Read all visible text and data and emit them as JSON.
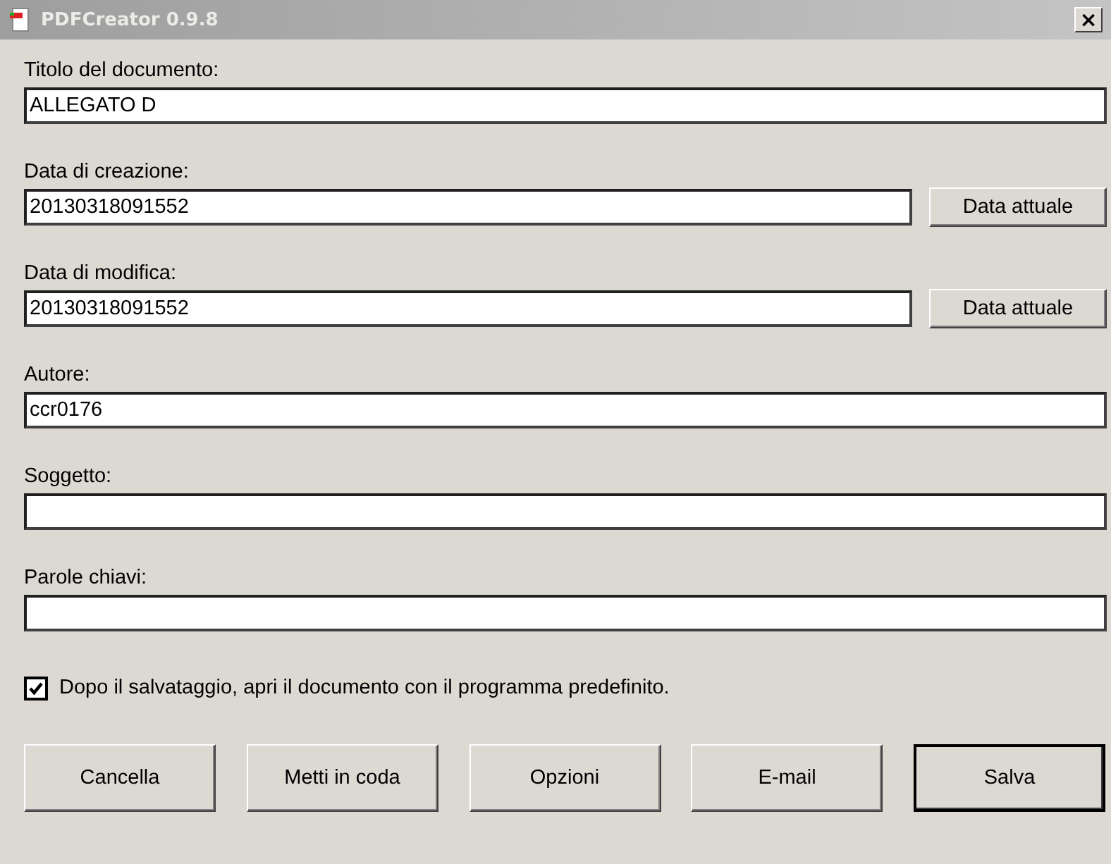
{
  "window": {
    "title": "PDFCreator 0.9.8",
    "close": "×"
  },
  "fields": [
    {
      "label": "Titolo del documento:",
      "value": "ALLEGATO D"
    },
    {
      "label": "Data di creazione:",
      "value": "20130318091552",
      "button": "Data attuale"
    },
    {
      "label": "Data di modifica:",
      "value": "20130318091552",
      "button": "Data attuale"
    },
    {
      "label": "Autore:",
      "value": "ccr0176"
    },
    {
      "label": "Soggetto:"
    },
    {
      "label": "Parole chiavi:"
    }
  ],
  "open_after_save": {
    "label": "Dopo il salvataggio, apri il documento con il programma predefinito.",
    "checked": true
  },
  "buttons": [
    {
      "label": "Cancella",
      "default": false
    },
    {
      "label": "Metti in coda",
      "default": false
    },
    {
      "label": "Opzioni",
      "default": false
    },
    {
      "label": "E-mail",
      "default": false
    },
    {
      "label": "Salva",
      "default": true
    }
  ]
}
